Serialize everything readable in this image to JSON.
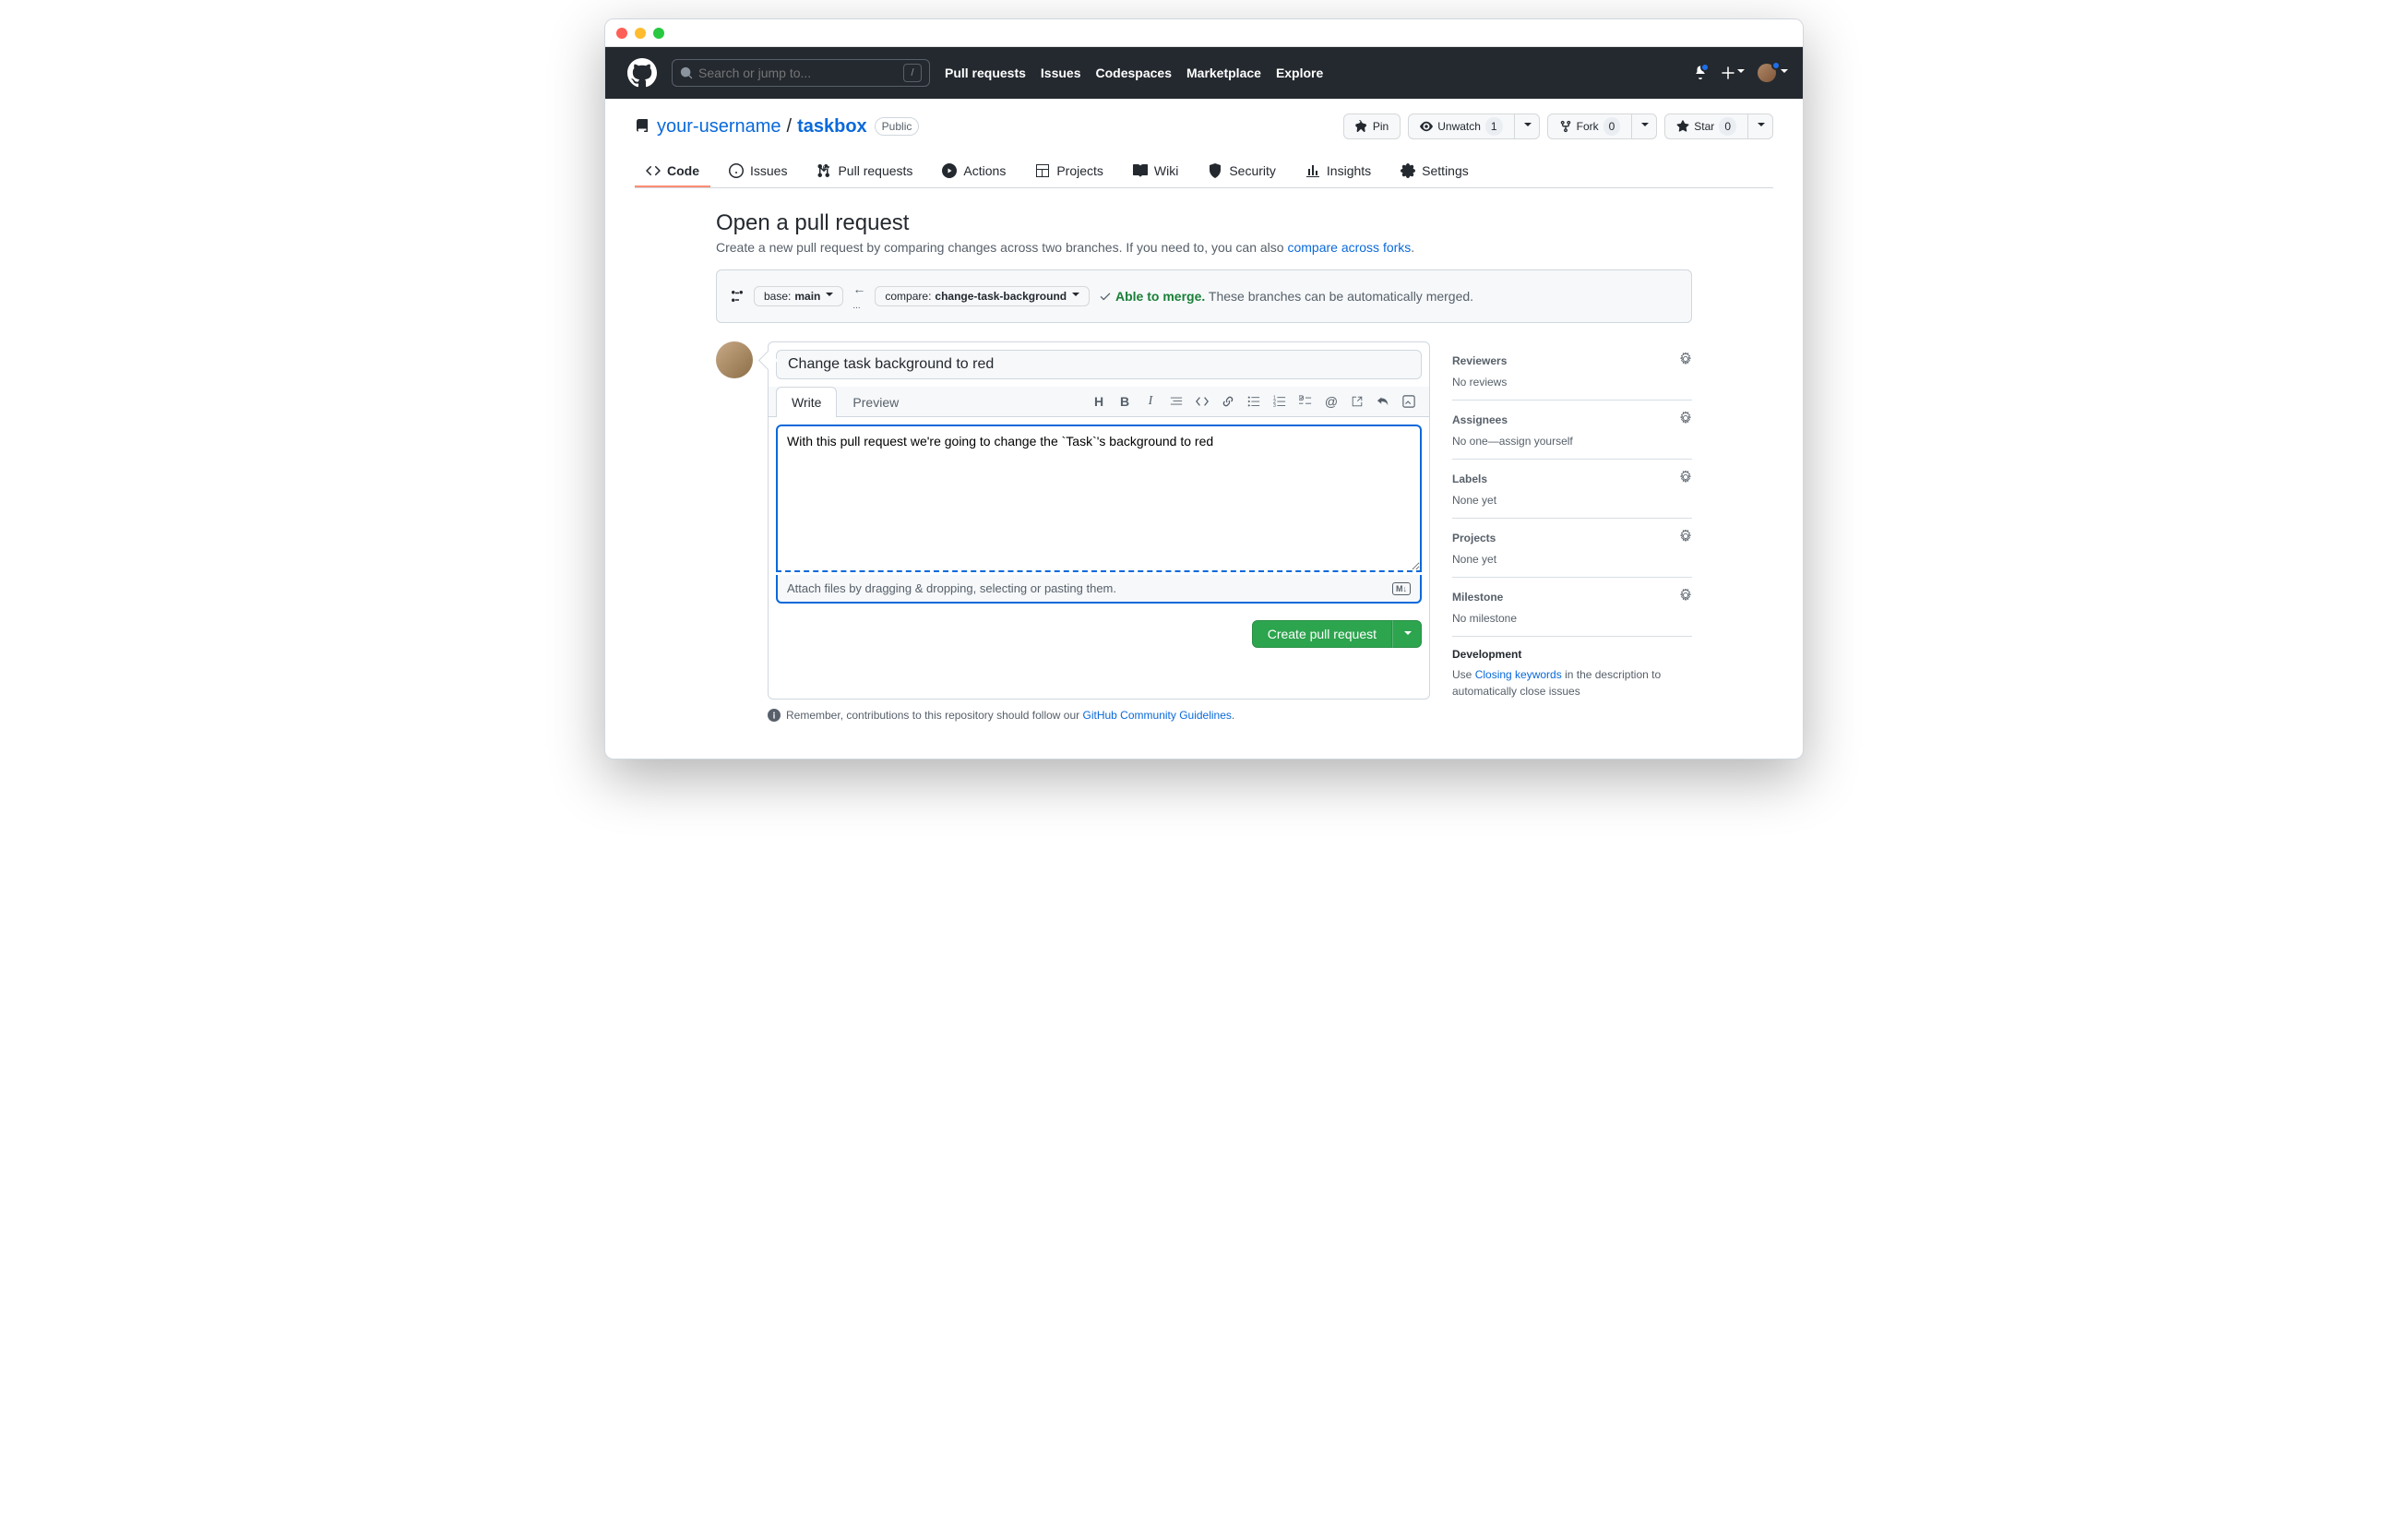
{
  "search": {
    "placeholder": "Search or jump to..."
  },
  "nav": {
    "pulls": "Pull requests",
    "issues": "Issues",
    "codespaces": "Codespaces",
    "marketplace": "Marketplace",
    "explore": "Explore"
  },
  "repo": {
    "owner": "your-username",
    "name": "taskbox",
    "visibility": "Public",
    "actions": {
      "pin": "Pin",
      "unwatch": "Unwatch",
      "watch_count": "1",
      "fork": "Fork",
      "fork_count": "0",
      "star": "Star",
      "star_count": "0"
    },
    "tabs": {
      "code": "Code",
      "issues": "Issues",
      "pulls": "Pull requests",
      "actions": "Actions",
      "projects": "Projects",
      "wiki": "Wiki",
      "security": "Security",
      "insights": "Insights",
      "settings": "Settings"
    }
  },
  "page": {
    "title": "Open a pull request",
    "subtitle_pre": "Create a new pull request by comparing changes across two branches. If you need to, you can also ",
    "subtitle_link": "compare across forks",
    "subtitle_post": "."
  },
  "range": {
    "base_label": "base: ",
    "base_value": "main",
    "compare_label": "compare: ",
    "compare_value": "change-task-background",
    "ok": "Able to merge.",
    "ok_detail": "These branches can be automatically merged."
  },
  "form": {
    "title_value": "Change task background to red",
    "tab_write": "Write",
    "tab_preview": "Preview",
    "body_value": "With this pull request we're going to change the `Task`'s background to red",
    "attach_hint": "Attach files by dragging & dropping, selecting or pasting them.",
    "submit": "Create pull request"
  },
  "footer": {
    "text_pre": "Remember, contributions to this repository should follow our ",
    "link": "GitHub Community Guidelines",
    "text_post": "."
  },
  "sidebar": {
    "reviewers": {
      "title": "Reviewers",
      "body": "No reviews"
    },
    "assignees": {
      "title": "Assignees",
      "body_pre": "No one—",
      "body_link": "assign yourself"
    },
    "labels": {
      "title": "Labels",
      "body": "None yet"
    },
    "projects": {
      "title": "Projects",
      "body": "None yet"
    },
    "milestone": {
      "title": "Milestone",
      "body": "No milestone"
    },
    "development": {
      "title": "Development",
      "text_pre": "Use ",
      "link": "Closing keywords",
      "text_post": " in the description to automatically close issues"
    }
  }
}
